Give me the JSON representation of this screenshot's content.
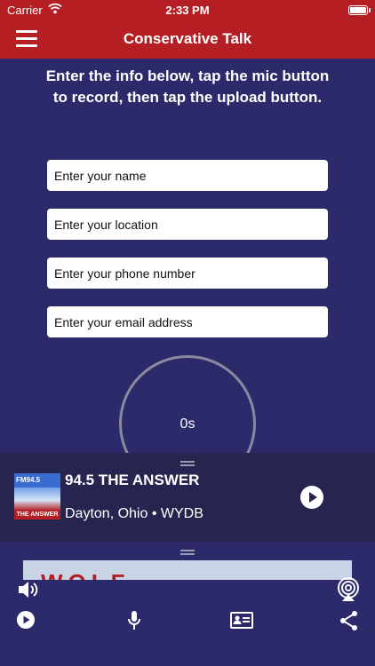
{
  "status_bar": {
    "carrier": "Carrier",
    "time": "2:33 PM"
  },
  "nav": {
    "title": "Conservative Talk",
    "menu_icon": "hamburger-menu-icon"
  },
  "instructions": "Enter the info below, tap the mic button to record, then tap the upload button.",
  "form": {
    "name_placeholder": "Enter your name",
    "location_placeholder": "Enter your location",
    "phone_placeholder": "Enter your phone number",
    "email_placeholder": "Enter your email address"
  },
  "recorder": {
    "timer": "0s"
  },
  "station": {
    "name": "94.5 THE ANSWER",
    "subtitle": "Dayton, Ohio • WYDB",
    "logo_top": "FM94.5",
    "logo_bottom": "THE ANSWER"
  },
  "banner": {
    "text": "WOLF"
  },
  "bottom_icons": [
    "volume-icon",
    "airplay-icon",
    "play-icon",
    "microphone-icon",
    "contact-card-icon",
    "share-icon"
  ],
  "colors": {
    "header": "#b51f24",
    "background": "#2c2a6b",
    "station_panel": "#27244f"
  }
}
